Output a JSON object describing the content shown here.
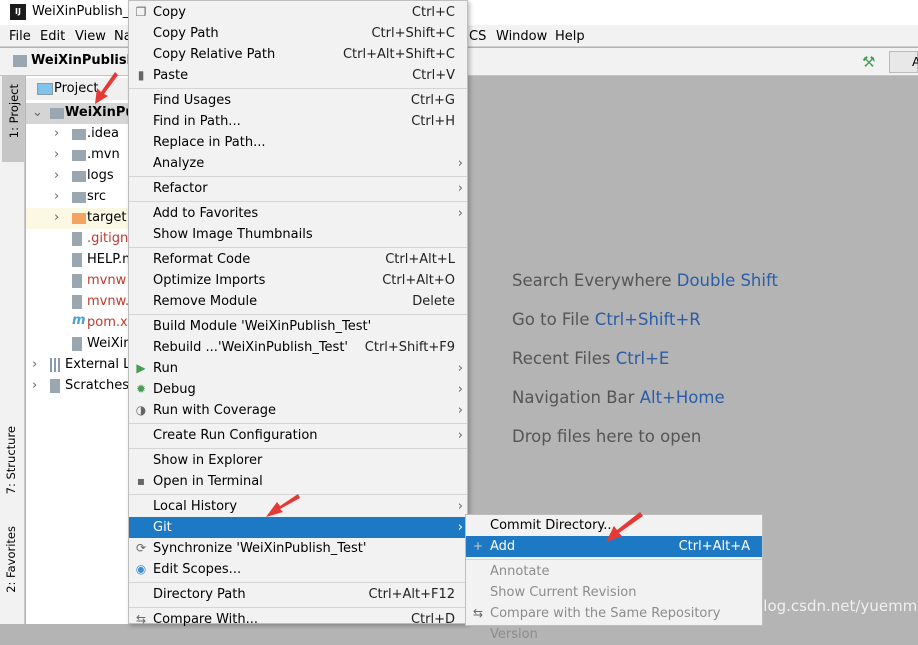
{
  "window": {
    "title": "WeiXinPublish_Te",
    "app_icon": "IJ"
  },
  "menubar": {
    "items": [
      "File",
      "Edit",
      "View",
      "Na",
      "CS",
      "Window",
      "Help"
    ]
  },
  "navbar": {
    "project": "WeiXinPublish_",
    "run_config_label": "A"
  },
  "toolwindows": {
    "project": "1: Project",
    "structure": "7: Structure",
    "favorites": "2: Favorites"
  },
  "project_panel": {
    "header": "Project",
    "tree": [
      {
        "label": "WeiXinPubl",
        "type": "module",
        "bold": true,
        "expanded": true
      },
      {
        "label": ".idea",
        "type": "folder"
      },
      {
        "label": ".mvn",
        "type": "folder"
      },
      {
        "label": "logs",
        "type": "folder"
      },
      {
        "label": "src",
        "type": "folder"
      },
      {
        "label": "target",
        "type": "folder-excluded"
      },
      {
        "label": ".gitigno",
        "type": "file",
        "color": "#c0392b"
      },
      {
        "label": "HELP.m",
        "type": "md"
      },
      {
        "label": "mvnw",
        "type": "file",
        "color": "#c0392b"
      },
      {
        "label": "mvnw.c",
        "type": "file",
        "color": "#c0392b"
      },
      {
        "label": "pom.xm",
        "type": "maven",
        "color": "#c0392b"
      },
      {
        "label": "WeiXinF",
        "type": "file"
      },
      {
        "label": "External Lib",
        "type": "library"
      },
      {
        "label": "Scratches a",
        "type": "scratch"
      }
    ]
  },
  "context_menu": {
    "items": [
      {
        "label": "Copy",
        "shortcut": "Ctrl+C",
        "icon": "copy-icon"
      },
      {
        "label": "Copy Path",
        "shortcut": "Ctrl+Shift+C"
      },
      {
        "label": "Copy Relative Path",
        "shortcut": "Ctrl+Alt+Shift+C"
      },
      {
        "label": "Paste",
        "shortcut": "Ctrl+V",
        "icon": "paste-icon"
      },
      {
        "sep": true
      },
      {
        "label": "Find Usages",
        "shortcut": "Ctrl+G"
      },
      {
        "label": "Find in Path...",
        "shortcut": "Ctrl+H"
      },
      {
        "label": "Replace in Path..."
      },
      {
        "label": "Analyze",
        "submenu": true
      },
      {
        "sep": true
      },
      {
        "label": "Refactor",
        "submenu": true
      },
      {
        "sep": true
      },
      {
        "label": "Add to Favorites",
        "submenu": true
      },
      {
        "label": "Show Image Thumbnails"
      },
      {
        "sep": true
      },
      {
        "label": "Reformat Code",
        "shortcut": "Ctrl+Alt+L"
      },
      {
        "label": "Optimize Imports",
        "shortcut": "Ctrl+Alt+O"
      },
      {
        "label": "Remove Module",
        "shortcut": "Delete"
      },
      {
        "sep": true
      },
      {
        "label": "Build Module 'WeiXinPublish_Test'"
      },
      {
        "label": "Rebuild ...'WeiXinPublish_Test'",
        "shortcut": "Ctrl+Shift+F9"
      },
      {
        "label": "Run",
        "submenu": true,
        "icon": "run-icon"
      },
      {
        "label": "Debug",
        "submenu": true,
        "icon": "debug-icon"
      },
      {
        "label": "Run with Coverage",
        "submenu": true,
        "icon": "coverage-icon"
      },
      {
        "sep": true
      },
      {
        "label": "Create Run Configuration",
        "submenu": true
      },
      {
        "sep": true
      },
      {
        "label": "Show in Explorer"
      },
      {
        "label": "Open in Terminal",
        "icon": "terminal-icon"
      },
      {
        "sep": true
      },
      {
        "label": "Local History",
        "submenu": true
      },
      {
        "label": "Git",
        "submenu": true,
        "selected": true
      },
      {
        "label": "Synchronize 'WeiXinPublish_Test'",
        "icon": "sync-icon"
      },
      {
        "label": "Edit Scopes...",
        "icon": "scopes-icon"
      },
      {
        "sep": true
      },
      {
        "label": "Directory Path",
        "shortcut": "Ctrl+Alt+F12"
      },
      {
        "sep": true
      },
      {
        "label": "Compare With...",
        "shortcut": "Ctrl+D",
        "icon": "compare-icon"
      }
    ]
  },
  "git_submenu": {
    "items": [
      {
        "label": "Commit Directory..."
      },
      {
        "label": "Add",
        "shortcut": "Ctrl+Alt+A",
        "selected": true,
        "icon": "plus-icon"
      },
      {
        "sep": true
      },
      {
        "label": "Annotate",
        "disabled": true
      },
      {
        "label": "Show Current Revision",
        "disabled": true
      },
      {
        "label": "Compare with the Same Repository Version",
        "disabled": true,
        "icon": "compare-icon"
      }
    ]
  },
  "editor_hints": [
    {
      "text": "Search Everywhere",
      "key": "Double Shift"
    },
    {
      "text": "Go to File",
      "key": "Ctrl+Shift+R"
    },
    {
      "text": "Recent Files",
      "key": "Ctrl+E"
    },
    {
      "text": "Navigation Bar",
      "key": "Alt+Home"
    },
    {
      "text": "Drop files here to open",
      "key": ""
    }
  ],
  "watermark": "https://blog.csdn.net/yuemmm",
  "colors": {
    "selection": "#1e79c5",
    "hint_key": "#2a5ca8",
    "annotation_arrow": "#e53935"
  }
}
